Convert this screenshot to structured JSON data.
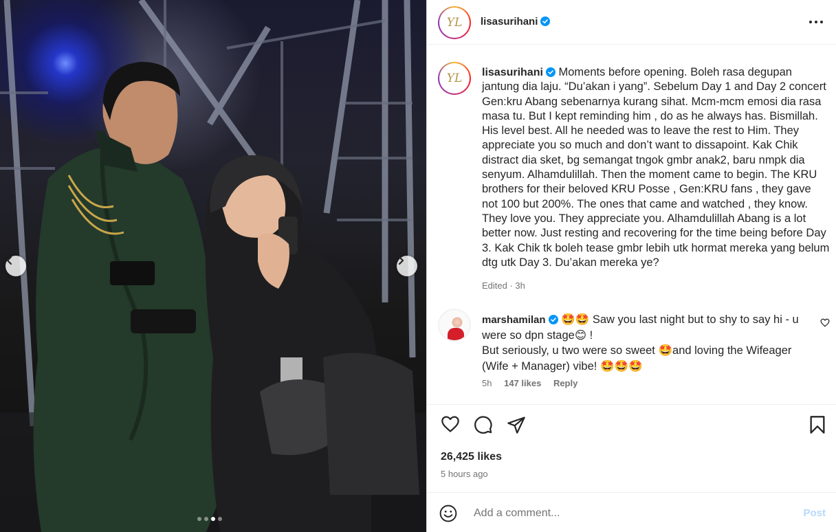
{
  "post": {
    "avatar_initials": "YL",
    "username": "lisasurihani",
    "accent_color": "#0095f6",
    "verified_color": "#0095f6"
  },
  "caption": {
    "username": "lisasurihani",
    "text": "Moments before opening. Boleh rasa degupan jantung dia laju. “Du’akan i yang”. Sebelum Day 1 and Day 2 concert Gen:kru Abang sebenarnya kurang sihat. Mcm-mcm emosi dia rasa masa tu. But I kept reminding him , do as he always has. Bismillah. His level best. All he needed was to leave the rest to Him. They appreciate you so much and don’t want to dissapoint. Kak Chik distract dia sket, bg semangat tngok gmbr anak2, baru nmpk dia senyum. Alhamdulillah. Then the moment came to begin. The KRU brothers for their beloved KRU Posse , Gen:KRU fans , they gave not 100 but 200%. The ones that came and watched , they know. They love you. They appreciate you. Alhamdulillah Abang is a lot better now. Just resting and recovering for the time being before Day 3. Kak Chik tk boleh tease gmbr lebih utk hormat mereka yang belum dtg utk Day 3. Du’akan mereka ye?",
    "meta": "Edited · 3h"
  },
  "comment": {
    "username": "marshamilan",
    "emoji_lead": "🤩🤩",
    "line1": "Saw you last night but to shy to say hi - u were so dpn stage",
    "emoji_blush": "😊",
    "line1_end": "!",
    "line2a": "But seriously, u two were so sweet",
    "emoji_mid": "🤩",
    "line2b": "and loving the Wifeager (Wife + Manager) vibe!",
    "emoji_tail": "🤩🤩🤩",
    "time": "5h",
    "likes": "147 likes",
    "reply": "Reply"
  },
  "stats": {
    "likes": "26,425 likes",
    "time": "5 hours ago"
  },
  "add_comment": {
    "placeholder": "Add a comment...",
    "post_label": "Post"
  },
  "carousel": {
    "total": 4,
    "active_index": 2
  },
  "icons": {
    "prev": "chevron-left-icon",
    "next": "chevron-right-icon",
    "like": "heart-icon",
    "comment": "comment-icon",
    "share": "share-icon",
    "save": "bookmark-icon",
    "more": "more-horizontal-icon",
    "emoji": "emoji-icon"
  }
}
